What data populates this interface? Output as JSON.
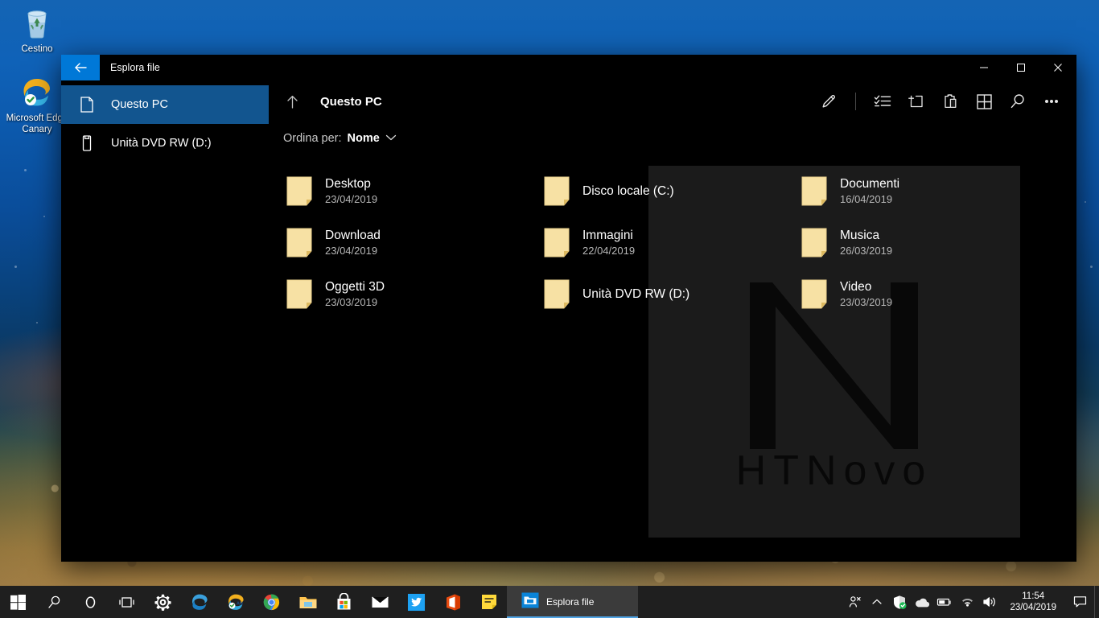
{
  "desktop": {
    "icons": [
      {
        "label": "Cestino",
        "icon": "recycle-bin-icon"
      },
      {
        "label": "Microsoft Edge Canary",
        "icon": "edge-canary-icon"
      }
    ]
  },
  "window": {
    "title": "Esplora file",
    "back_icon": "back-arrow-icon",
    "controls": {
      "minimize": "minimize-icon",
      "maximize": "maximize-icon",
      "close": "close-icon"
    }
  },
  "sidebar": {
    "items": [
      {
        "label": "Questo PC",
        "icon": "this-pc-icon",
        "active": true
      },
      {
        "label": "Unità DVD RW (D:)",
        "icon": "dvd-drive-icon",
        "active": false
      }
    ]
  },
  "command_bar": {
    "up_icon": "up-arrow-icon",
    "breadcrumb": "Questo PC",
    "buttons": [
      {
        "name": "edit-button",
        "icon": "pencil-icon"
      },
      {
        "name": "select-button",
        "icon": "checklist-icon"
      },
      {
        "name": "new-folder-button",
        "icon": "new-folder-icon"
      },
      {
        "name": "paste-button",
        "icon": "clipboard-icon"
      },
      {
        "name": "view-button",
        "icon": "grid-view-icon"
      },
      {
        "name": "search-button",
        "icon": "search-icon"
      },
      {
        "name": "more-button",
        "icon": "ellipsis-icon"
      }
    ]
  },
  "sort": {
    "label": "Ordina per:",
    "value": "Nome",
    "chevron_icon": "chevron-down-icon"
  },
  "files": [
    {
      "name": "Desktop",
      "date": "23/04/2019",
      "icon": "folder-icon"
    },
    {
      "name": "Disco locale (C:)",
      "date": "",
      "icon": "folder-icon"
    },
    {
      "name": "Documenti",
      "date": "16/04/2019",
      "icon": "folder-icon"
    },
    {
      "name": "Download",
      "date": "23/04/2019",
      "icon": "folder-icon"
    },
    {
      "name": "Immagini",
      "date": "22/04/2019",
      "icon": "folder-icon"
    },
    {
      "name": "Musica",
      "date": "26/03/2019",
      "icon": "folder-icon"
    },
    {
      "name": "Oggetti 3D",
      "date": "23/03/2019",
      "icon": "folder-icon"
    },
    {
      "name": "Unità DVD RW (D:)",
      "date": "",
      "icon": "folder-icon"
    },
    {
      "name": "Video",
      "date": "23/03/2019",
      "icon": "folder-icon"
    }
  ],
  "watermark": {
    "wordmark": "HTNovo",
    "logo_letter": "N"
  },
  "taskbar": {
    "items": [
      {
        "name": "start-button",
        "icon": "windows-logo-icon"
      },
      {
        "name": "search-button",
        "icon": "search-icon"
      },
      {
        "name": "cortana-button",
        "icon": "cortana-icon"
      },
      {
        "name": "task-view-button",
        "icon": "task-view-icon"
      },
      {
        "name": "settings-button",
        "icon": "gear-icon"
      },
      {
        "name": "edge-button",
        "icon": "edge-icon"
      },
      {
        "name": "edge-canary-button",
        "icon": "edge-canary-icon"
      },
      {
        "name": "chrome-button",
        "icon": "chrome-icon"
      },
      {
        "name": "file-explorer-button",
        "icon": "folder-icon"
      },
      {
        "name": "store-button",
        "icon": "microsoft-store-icon"
      },
      {
        "name": "mail-button",
        "icon": "mail-icon"
      },
      {
        "name": "twitter-button",
        "icon": "twitter-icon"
      },
      {
        "name": "office-button",
        "icon": "office-icon"
      },
      {
        "name": "sticky-notes-button",
        "icon": "sticky-notes-icon"
      }
    ],
    "active_window": {
      "label": "Esplora file",
      "icon": "file-explorer-icon"
    },
    "tray": [
      {
        "name": "people-icon"
      },
      {
        "name": "chevron-up-icon"
      },
      {
        "name": "security-shield-icon"
      },
      {
        "name": "onedrive-cloud-icon"
      },
      {
        "name": "battery-icon"
      },
      {
        "name": "wifi-icon"
      },
      {
        "name": "volume-icon"
      }
    ],
    "clock": {
      "time": "11:54",
      "date": "23/04/2019"
    },
    "notification_icon": "notification-center-icon"
  },
  "colors": {
    "accent": "#0078d7",
    "sidebar_active": "#12558f",
    "window_bg": "#000000",
    "watermark_panel": "#1b1b1b",
    "folder_yellow": "#f5dd9a",
    "taskbar": "#1f1f1f"
  }
}
